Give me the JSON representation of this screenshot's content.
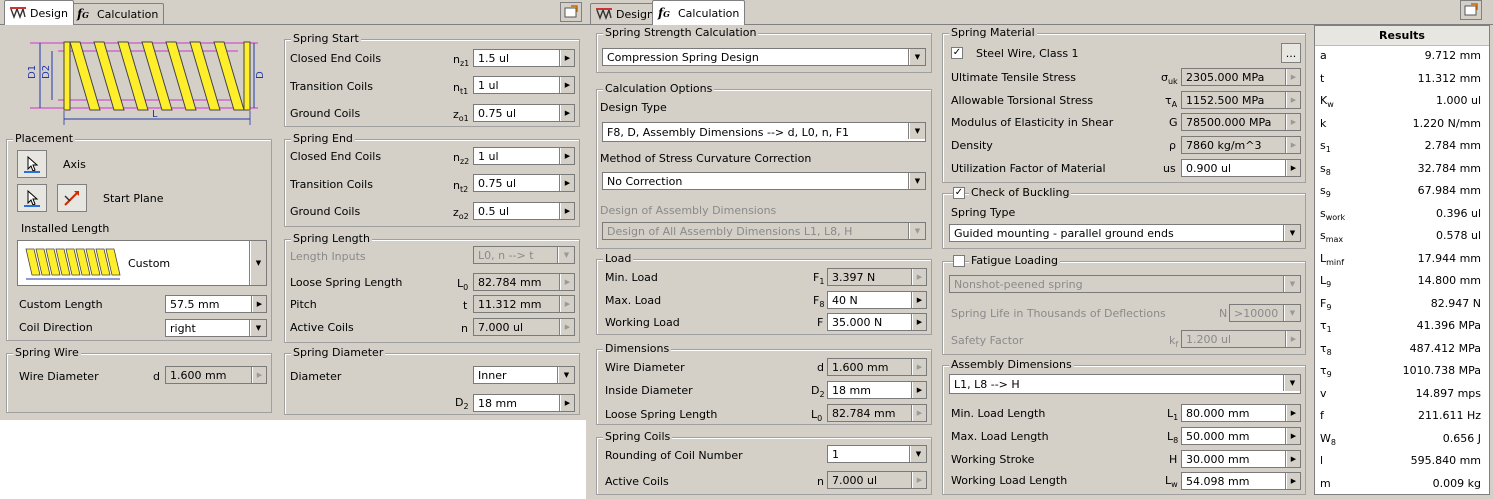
{
  "left": {
    "tabs": {
      "design": "Design",
      "calculation": "Calculation"
    },
    "spring_start": {
      "title": "Spring Start",
      "rows": [
        {
          "label": "Closed End Coils",
          "sym": "n",
          "sub": "z1",
          "value": "1.5 ul"
        },
        {
          "label": "Transition Coils",
          "sym": "n",
          "sub": "t1",
          "value": "1 ul"
        },
        {
          "label": "Ground Coils",
          "sym": "z",
          "sub": "o1",
          "value": "0.75 ul"
        }
      ]
    },
    "spring_end": {
      "title": "Spring End",
      "rows": [
        {
          "label": "Closed End Coils",
          "sym": "n",
          "sub": "z2",
          "value": "1 ul"
        },
        {
          "label": "Transition Coils",
          "sym": "n",
          "sub": "t2",
          "value": "0.75 ul"
        },
        {
          "label": "Ground Coils",
          "sym": "z",
          "sub": "o2",
          "value": "0.5 ul"
        }
      ]
    },
    "spring_length": {
      "title": "Spring Length",
      "inputs_label": "Length Inputs",
      "inputs_value": "L0, n --> t",
      "rows": [
        {
          "label": "Loose Spring Length",
          "sym": "L",
          "sub": "0",
          "value": "82.784 mm"
        },
        {
          "label": "Pitch",
          "sym": "t",
          "sub": "",
          "value": "11.312 mm"
        },
        {
          "label": "Active Coils",
          "sym": "n",
          "sub": "",
          "value": "7.000 ul"
        }
      ]
    },
    "spring_diameter": {
      "title": "Spring Diameter",
      "diameter_label": "Diameter",
      "diameter_value": "Inner",
      "d2_sym": "D",
      "d2_sub": "2",
      "d2_value": "18 mm"
    },
    "diagram": {
      "d1": "D1",
      "d2": "D2",
      "d": "D",
      "l": "L"
    },
    "placement": {
      "title": "Placement",
      "axis": "Axis",
      "start_plane": "Start Plane",
      "installed_length": "Installed Length",
      "installed_value": "Custom",
      "custom_length_label": "Custom Length",
      "custom_length_value": "57.5 mm",
      "coil_direction_label": "Coil Direction",
      "coil_direction_value": "right"
    },
    "spring_wire": {
      "title": "Spring Wire",
      "label": "Wire Diameter",
      "sym": "d",
      "value": "1.600 mm"
    }
  },
  "right": {
    "tabs": {
      "design": "Design",
      "calculation": "Calculation"
    },
    "strength": {
      "title": "Spring Strength Calculation",
      "value": "Compression Spring Design"
    },
    "options": {
      "title": "Calculation Options",
      "design_type_label": "Design Type",
      "design_type_value": "F8, D, Assembly Dimensions --> d, L0, n, F1",
      "stress_label": "Method of Stress Curvature Correction",
      "stress_value": "No Correction",
      "assembly_label": "Design of Assembly Dimensions",
      "assembly_value": "Design of All Assembly Dimensions L1, L8, H"
    },
    "load": {
      "title": "Load",
      "rows": [
        {
          "label": "Min. Load",
          "sym": "F",
          "sub": "1",
          "value": "3.397 N"
        },
        {
          "label": "Max. Load",
          "sym": "F",
          "sub": "8",
          "value": "40 N"
        },
        {
          "label": "Working Load",
          "sym": "F",
          "sub": "",
          "value": "35.000 N"
        }
      ]
    },
    "dimensions": {
      "title": "Dimensions",
      "rows": [
        {
          "label": "Wire Diameter",
          "sym": "d",
          "sub": "",
          "value": "1.600 mm"
        },
        {
          "label": "Inside Diameter",
          "sym": "D",
          "sub": "2",
          "value": "18 mm"
        },
        {
          "label": "Loose Spring Length",
          "sym": "L",
          "sub": "0",
          "value": "82.784 mm"
        }
      ]
    },
    "coils": {
      "title": "Spring Coils",
      "rounding_label": "Rounding of Coil Number",
      "rounding_value": "1",
      "active_label": "Active Coils",
      "active_sym": "n",
      "active_value": "7.000 ul"
    },
    "material": {
      "title": "Spring Material",
      "value": "Steel Wire, Class 1",
      "browse": "...",
      "rows": [
        {
          "label": "Ultimate Tensile Stress",
          "sym": "σ",
          "sub": "uk",
          "value": "2305.000 MPa"
        },
        {
          "label": "Allowable Torsional Stress",
          "sym": "τ",
          "sub": "A",
          "value": "1152.500 MPa"
        },
        {
          "label": "Modulus of Elasticity in Shear",
          "sym": "G",
          "sub": "",
          "value": "78500.000 MPa"
        },
        {
          "label": "Density",
          "sym": "ρ",
          "sub": "",
          "value": "7860 kg/m^3"
        },
        {
          "label": "Utilization Factor of Material",
          "sym": "us",
          "sub": "",
          "value": "0.900 ul"
        }
      ]
    },
    "buckling": {
      "title": "Check of Buckling",
      "type_label": "Spring Type",
      "type_value": "Guided mounting - parallel ground ends"
    },
    "fatigue": {
      "title": "Fatigue Loading",
      "peened_value": "Nonshot-peened spring",
      "life_label": "Spring Life in Thousands of Deflections",
      "life_sym": "N",
      "life_value": ">10000",
      "safety_label": "Safety Factor",
      "safety_sym": "k",
      "safety_sub": "f",
      "safety_value": "1.200 ul"
    },
    "assembly": {
      "title": "Assembly Dimensions",
      "mode_value": "L1, L8 --> H",
      "rows": [
        {
          "label": "Min. Load Length",
          "sym": "L",
          "sub": "1",
          "value": "80.000 mm"
        },
        {
          "label": "Max. Load Length",
          "sym": "L",
          "sub": "8",
          "value": "50.000 mm"
        },
        {
          "label": "Working Stroke",
          "sym": "H",
          "sub": "",
          "value": "30.000 mm"
        },
        {
          "label": "Working Load Length",
          "sym": "L",
          "sub": "w",
          "value": "54.098 mm"
        }
      ]
    },
    "results": {
      "title": "Results",
      "rows": [
        {
          "k": "a",
          "s": "",
          "v": "9.712 mm"
        },
        {
          "k": "t",
          "s": "",
          "v": "11.312 mm"
        },
        {
          "k": "K",
          "s": "w",
          "v": "1.000 ul"
        },
        {
          "k": "k",
          "s": "",
          "v": "1.220 N/mm"
        },
        {
          "k": "s",
          "s": "1",
          "v": "2.784 mm"
        },
        {
          "k": "s",
          "s": "8",
          "v": "32.784 mm"
        },
        {
          "k": "s",
          "s": "9",
          "v": "67.984 mm"
        },
        {
          "k": "s",
          "s": "work",
          "v": "0.396 ul"
        },
        {
          "k": "s",
          "s": "max",
          "v": "0.578 ul"
        },
        {
          "k": "L",
          "s": "minf",
          "v": "17.944 mm"
        },
        {
          "k": "L",
          "s": "9",
          "v": "14.800 mm"
        },
        {
          "k": "F",
          "s": "9",
          "v": "82.947 N"
        },
        {
          "k": "τ",
          "s": "1",
          "v": "41.396 MPa"
        },
        {
          "k": "τ",
          "s": "8",
          "v": "487.412 MPa"
        },
        {
          "k": "τ",
          "s": "9",
          "v": "1010.738 MPa"
        },
        {
          "k": "v",
          "s": "",
          "v": "14.897 mps"
        },
        {
          "k": "f",
          "s": "",
          "v": "211.611 Hz"
        },
        {
          "k": "W",
          "s": "8",
          "v": "0.656 J"
        },
        {
          "k": "l",
          "s": "",
          "v": "595.840 mm"
        },
        {
          "k": "m",
          "s": "",
          "v": "0.009 kg"
        }
      ]
    }
  }
}
